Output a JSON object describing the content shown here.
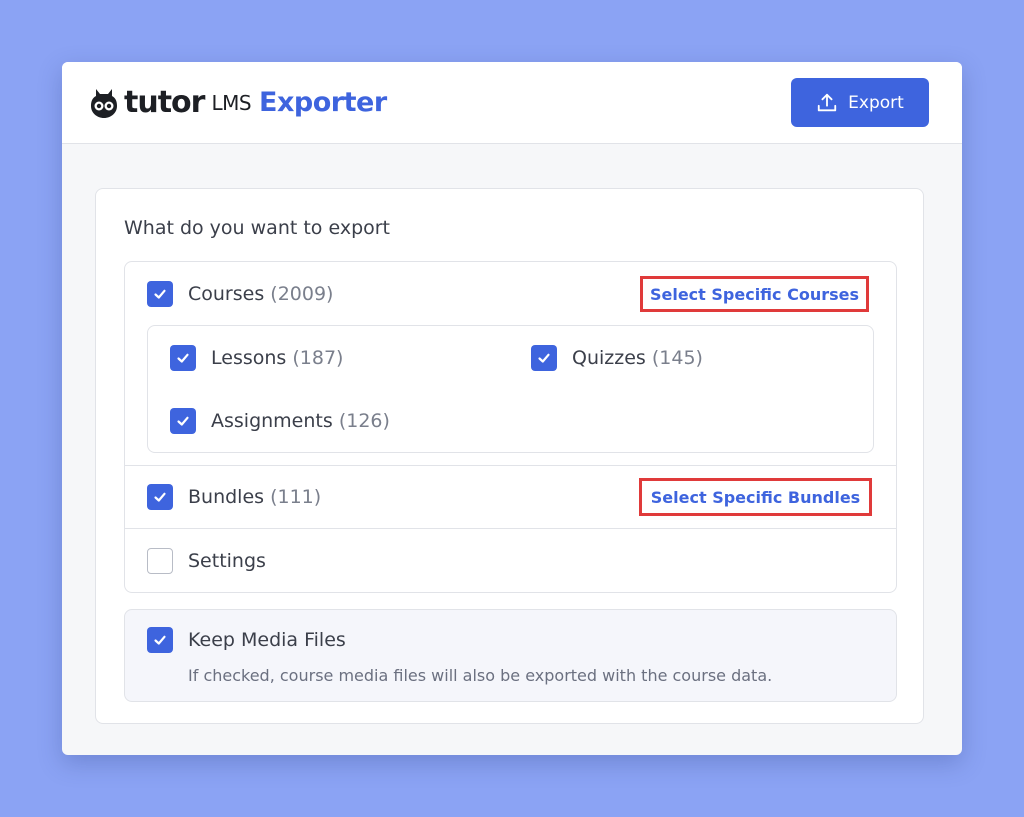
{
  "header": {
    "brand_tutor": "tutor",
    "brand_lms": "LMS",
    "brand_exporter": "Exporter",
    "export_label": "Export"
  },
  "panel": {
    "title": "What do you want to export"
  },
  "options": {
    "courses": {
      "label": "Courses",
      "count": "(2009)",
      "checked": true,
      "link": "Select Specific Courses"
    },
    "lessons": {
      "label": "Lessons",
      "count": "(187)",
      "checked": true
    },
    "quizzes": {
      "label": "Quizzes",
      "count": "(145)",
      "checked": true
    },
    "assignments": {
      "label": "Assignments",
      "count": "(126)",
      "checked": true
    },
    "bundles": {
      "label": "Bundles",
      "count": "(111)",
      "checked": true,
      "link": "Select Specific Bundles"
    },
    "settings": {
      "label": "Settings",
      "checked": false
    }
  },
  "media": {
    "label": "Keep Media Files",
    "checked": true,
    "description": "If checked, course media files will also be exported with the course data."
  },
  "colors": {
    "background": "#8ba3f4",
    "accent": "#3e64de",
    "highlight_border": "#e03a3a"
  },
  "icons": {
    "brand": "tutor-owl-icon",
    "export": "upload-icon",
    "check": "checkmark-icon"
  }
}
